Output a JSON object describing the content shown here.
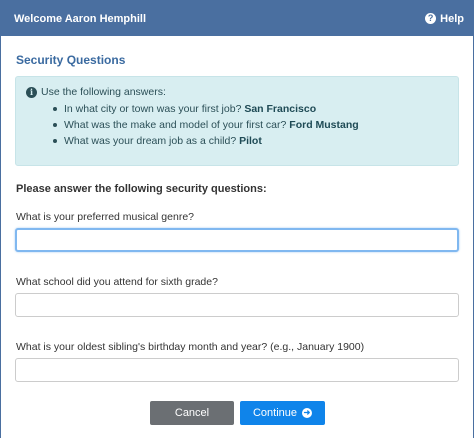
{
  "window": {
    "title": "Welcome Aaron Hemphill",
    "help_label": "Help",
    "help_icon": "?"
  },
  "section": {
    "title": "Security Questions"
  },
  "info": {
    "icon": "i",
    "intro": "Use the following answers:",
    "items": [
      {
        "question": "In what city or town was your first job?",
        "answer": "San Francisco"
      },
      {
        "question": "What was the make and model of your first car?",
        "answer": "Ford Mustang"
      },
      {
        "question": "What was your dream job as a child?",
        "answer": "Pilot"
      }
    ]
  },
  "form": {
    "instruction": "Please answer the following security questions:",
    "questions": [
      {
        "label": "What is your preferred musical genre?",
        "value": ""
      },
      {
        "label": "What school did you attend for sixth grade?",
        "value": ""
      },
      {
        "label": "What is your oldest sibling's birthday month and year? (e.g., January 1900)",
        "value": ""
      }
    ]
  },
  "buttons": {
    "cancel": "Cancel",
    "continue": "Continue",
    "continue_icon": "➜"
  },
  "colors": {
    "titlebar": "#4a6fa0",
    "info_bg": "#d8eef1",
    "continue": "#0f84ea",
    "cancel": "#6b6f73"
  }
}
